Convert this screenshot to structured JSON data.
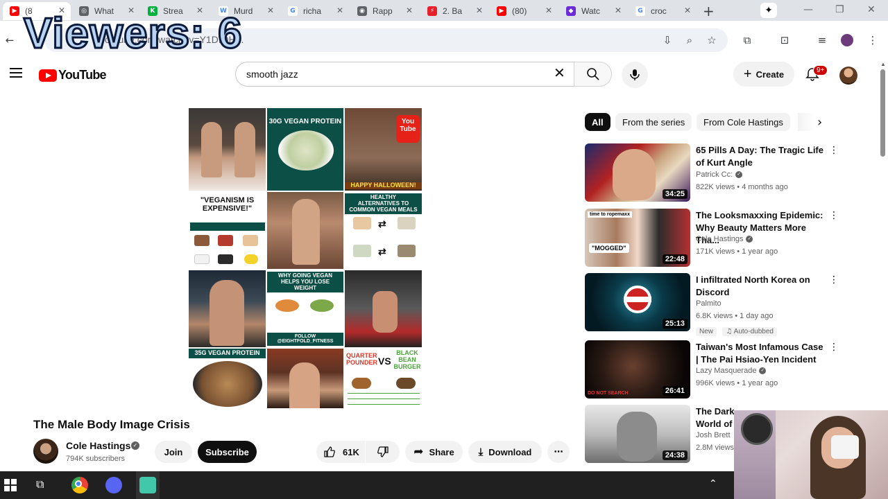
{
  "overlay": {
    "viewers_text": "Viewers: 6"
  },
  "browser": {
    "tabs": [
      {
        "label": "(8",
        "color": "#ff0000",
        "glyph": "▶",
        "active": true
      },
      {
        "label": "What",
        "color": "#5f6368",
        "glyph": "◎"
      },
      {
        "label": "Strea",
        "color": "#00b140",
        "glyph": "K"
      },
      {
        "label": "Murd",
        "color": "#ffffff",
        "glyph": "W"
      },
      {
        "label": "richa",
        "color": "#ffffff",
        "glyph": "G"
      },
      {
        "label": "Rapp",
        "color": "#5f6368",
        "glyph": "◉"
      },
      {
        "label": "2. Ba",
        "color": "#e8202a",
        "glyph": "⚡"
      },
      {
        "label": "(80)",
        "color": "#ff0000",
        "glyph": "▶"
      },
      {
        "label": "Watc",
        "color": "#6c2bd9",
        "glyph": "◆"
      },
      {
        "label": "croc",
        "color": "#ffffff",
        "glyph": "G"
      }
    ],
    "new_tab": "+",
    "url": "youtube.com/watch?v=Y1DIOH..."
  },
  "youtube": {
    "logo_text": "YouTube",
    "search": {
      "value": "smooth jazz",
      "placeholder": "Search"
    },
    "create_label": "Create",
    "notification_count": "9+"
  },
  "video": {
    "title": "The Male Body Image Crisis",
    "channel": "Cole Hastings",
    "subscribers": "794K subscribers",
    "join_label": "Join",
    "subscribe_label": "Subscribe",
    "likes": "61K",
    "share_label": "Share",
    "download_label": "Download",
    "collage_text": {
      "protein": "30G VEGAN PROTEIN",
      "halloween": "HAPPY HALLOWEEN!",
      "veganism": "\"VEGANISM IS EXPENSIVE!\"",
      "alternatives": "HEALTHY ALTERNATIVES TO COMMON VEGAN MEALS",
      "lose_weight": "WHY GOING VEGAN HELPS YOU LOSE WEIGHT",
      "follow": "FOLLOW @EIGHTFOLD_FITNESS",
      "protein2": "35G VEGAN PROTEIN",
      "quarter": "QUARTER POUNDER",
      "vs": "VS",
      "bean": "BLACK BEAN BURGER",
      "youtube": "You Tube"
    }
  },
  "chips": [
    {
      "label": "All",
      "active": true
    },
    {
      "label": "From the series"
    },
    {
      "label": "From Cole Hastings"
    }
  ],
  "recommendations": [
    {
      "title": "65 Pills A Day: The Tragic Life of Kurt Angle",
      "channel": "Patrick Cc:",
      "verified": true,
      "meta": "822K views • 4 months ago",
      "duration": "34:25"
    },
    {
      "title": "The Looksmaxxing Epidemic: Why Beauty Matters More Tha...",
      "channel": "Cole Hastings",
      "verified": true,
      "meta": "171K views • 1 year ago",
      "duration": "22:48"
    },
    {
      "title": "I infiltrated North Korea on Discord",
      "channel": "Palmito",
      "verified": false,
      "meta": "6.8K views • 1 day ago",
      "duration": "25:13",
      "badges": [
        "New",
        "Auto-dubbed"
      ]
    },
    {
      "title": "Taiwan's Most Infamous Case | The Pai Hsiao-Yen Incident",
      "channel": "Lazy Masquerade",
      "verified": true,
      "meta": "996K views • 1 year ago",
      "duration": "26:41"
    },
    {
      "title": "The Dark World of Unrealistic Male Bod...",
      "channel": "Josh Brett",
      "verified": false,
      "meta": "2.8M views • ...",
      "duration": "24:38"
    }
  ],
  "thumb_text": {
    "rec1_mogged": "\"MOGGED\"",
    "rec1_time": "time to ropemaxx",
    "rec3_search": "DO NOT SEARCH"
  }
}
